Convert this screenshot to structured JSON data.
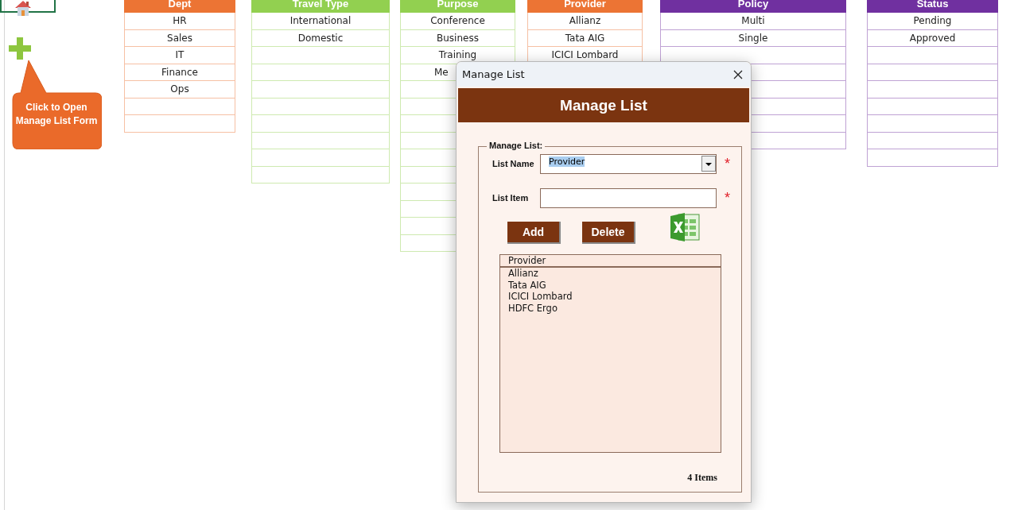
{
  "sheet": {
    "tables": [
      {
        "header": "Dept",
        "color": "#ec7434",
        "items": [
          {
            "text": "HR"
          },
          {
            "text": "Sales"
          },
          {
            "text": "IT"
          },
          {
            "text": "Finance"
          },
          {
            "text": "Ops"
          }
        ]
      },
      {
        "header": "Travel Type",
        "color": "#92d050",
        "items": [
          {
            "text": "International"
          },
          {
            "text": "Domestic"
          }
        ]
      },
      {
        "header": "Purpose",
        "color": "#92d050",
        "items": [
          {
            "text": "Conference"
          },
          {
            "text": "Business"
          },
          {
            "text": "Training"
          },
          {
            "text": "Me",
            "clipped": true
          }
        ]
      },
      {
        "header": "Provider",
        "color": "#ec7434",
        "items": [
          {
            "text": "Allianz"
          },
          {
            "text": "Tata AIG"
          },
          {
            "text": "ICICI Lombard"
          }
        ]
      },
      {
        "header": "Policy",
        "color": "#7030a0",
        "items": [
          {
            "text": "Multi"
          },
          {
            "text": "Single"
          }
        ]
      },
      {
        "header": "Status",
        "color": "#7030a0",
        "items": [
          {
            "text": "Pending"
          },
          {
            "text": "Approved"
          }
        ]
      }
    ]
  },
  "callout": {
    "text": "Click to Open Manage List Form"
  },
  "dialog": {
    "title": "Manage List",
    "banner": "Manage List",
    "group_label": "Manage List:",
    "fields": [
      {
        "kind": "combo",
        "label": "List Name",
        "value": "Provider",
        "text_selected": true,
        "required_mark": "*"
      },
      {
        "kind": "text",
        "label": "List Item",
        "required_mark": "*"
      }
    ],
    "buttons": [
      "Add",
      "Delete"
    ],
    "list": {
      "header": "Provider",
      "items": [
        "Allianz",
        "Tata AIG",
        "ICICI Lombard",
        "HDFC Ergo"
      ]
    },
    "count": "4 Items"
  }
}
